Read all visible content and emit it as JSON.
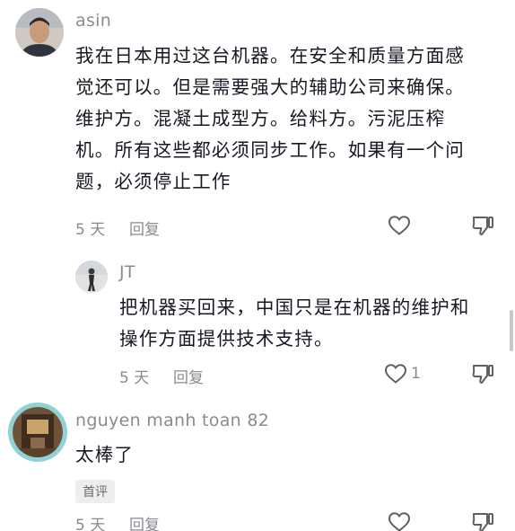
{
  "comments": [
    {
      "username": "asin",
      "text": "我在日本用过这台机器。在安全和质量方面感\n觉还可以。但是需要强大的辅助公司来确保。\n维护方。混凝土成型方。给料方。污泥压榨\n机。所有这些都必须同步工作。如果有一个问\n题，必须停止工作",
      "time": "5 天",
      "reply_label": "回复",
      "like_icon": "heart-outline-icon",
      "dislike_icon": "thumbs-down-icon"
    },
    {
      "username": "JT",
      "text": "把机器买回来，中国只是在机器的维护和\n操作方面提供技术支持。",
      "time": "5 天",
      "reply_label": "回复",
      "like_count": "1",
      "like_icon": "heart-outline-icon",
      "dislike_icon": "thumbs-down-icon"
    },
    {
      "username": "nguyen manh toan 82",
      "text": "太棒了",
      "badge": "首评",
      "time": "5 天",
      "reply_label": "回复",
      "like_icon": "heart-outline-icon",
      "dislike_icon": "thumbs-down-icon"
    }
  ],
  "colors": {
    "text": "#161823",
    "muted": "#8a8b91",
    "badge_bg": "#eeeeef",
    "avatar_ring": "#8fd3d9"
  }
}
